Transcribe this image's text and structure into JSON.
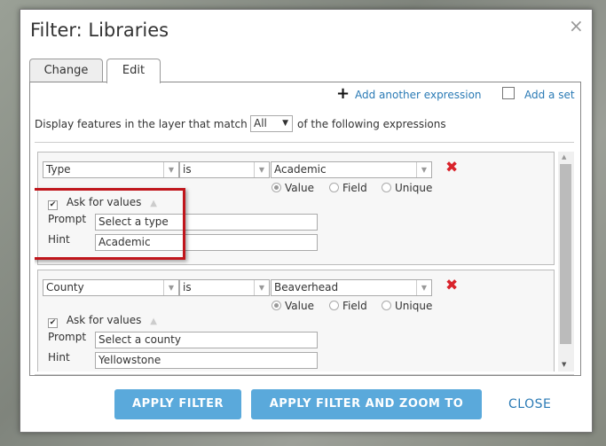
{
  "dialog": {
    "title": "Filter: Libraries"
  },
  "tabs": [
    {
      "label": "Change"
    },
    {
      "label": "Edit"
    }
  ],
  "toolbar": {
    "add_expression": "Add another expression",
    "add_set": "Add a set"
  },
  "match": {
    "prefix": "Display features in the layer that match",
    "value": "All",
    "suffix": "of the following expressions"
  },
  "expressions": [
    {
      "field": "Type",
      "operator": "is",
      "value": "Academic",
      "ask_for_values": true,
      "prompt": "Select a type",
      "hint": "Academic"
    },
    {
      "field": "County",
      "operator": "is",
      "value": "Beaverhead",
      "ask_for_values": true,
      "prompt": "Select a county",
      "hint": "Yellowstone"
    }
  ],
  "labels": {
    "value": "Value",
    "field": "Field",
    "unique": "Unique",
    "ask": "Ask for values",
    "prompt": "Prompt",
    "hint": "Hint"
  },
  "buttons": {
    "apply": "APPLY FILTER",
    "apply_zoom": "APPLY FILTER AND ZOOM TO",
    "close": "CLOSE"
  },
  "colors": {
    "accent": "#5aa9db",
    "link": "#2a7ab5",
    "highlight": "#c0161c",
    "delete": "#d9232b"
  }
}
